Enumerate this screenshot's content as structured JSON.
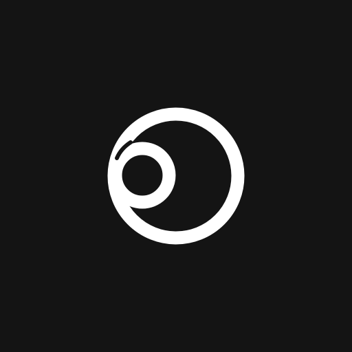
{
  "app_icon": {
    "icon": "circle-orbit-logo-icon",
    "background_color": "#141414",
    "foreground_color": "#ffffff"
  }
}
